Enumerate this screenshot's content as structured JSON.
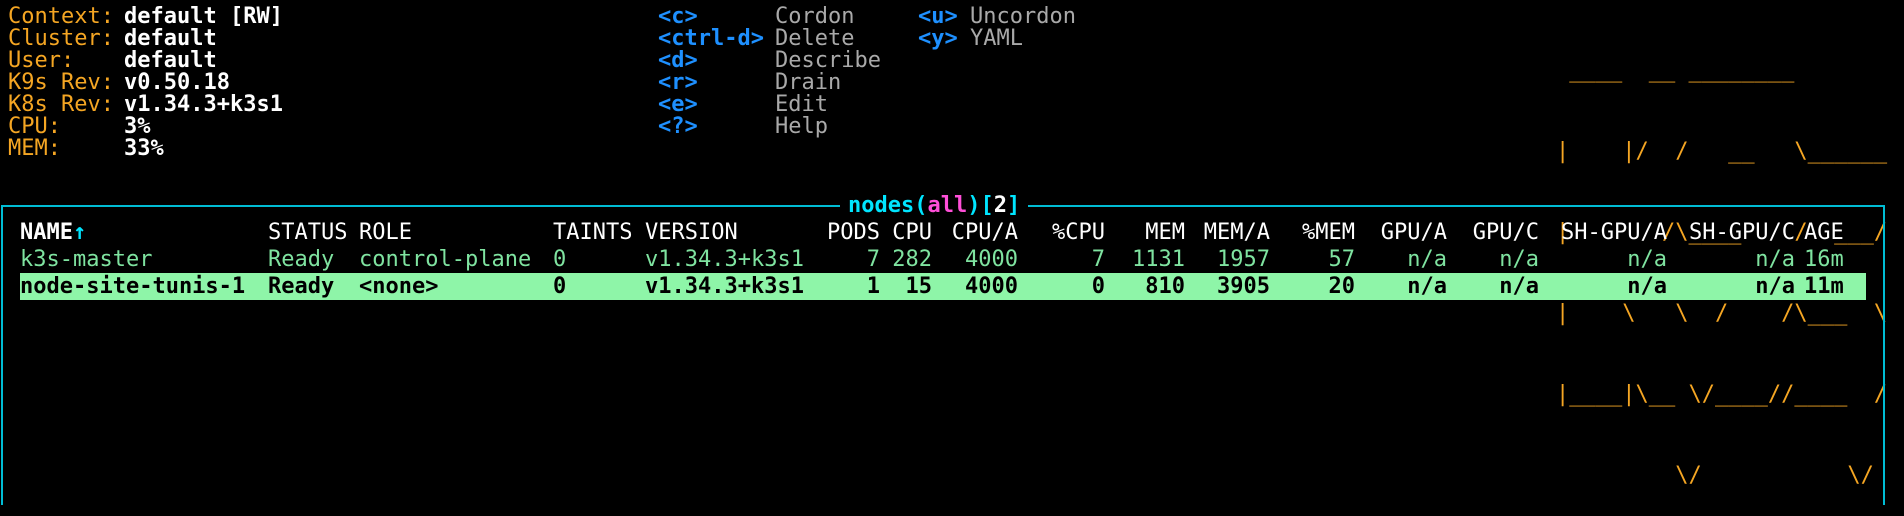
{
  "header": {
    "info": [
      {
        "label": "Context:",
        "value": "default [RW]"
      },
      {
        "label": "Cluster:",
        "value": "default"
      },
      {
        "label": "User:",
        "value": "default"
      },
      {
        "label": "K9s Rev:",
        "value": "v0.50.18"
      },
      {
        "label": "K8s Rev:",
        "value": "v1.34.3+k3s1"
      },
      {
        "label": "CPU:",
        "value": "3%"
      },
      {
        "label": "MEM:",
        "value": "33%"
      }
    ],
    "shortcuts_col1": [
      {
        "key": "<c>",
        "desc": "Cordon"
      },
      {
        "key": "<ctrl-d>",
        "desc": "Delete"
      },
      {
        "key": "<d>",
        "desc": "Describe"
      },
      {
        "key": "<r>",
        "desc": "Drain"
      },
      {
        "key": "<e>",
        "desc": "Edit"
      },
      {
        "key": "<?>",
        "desc": "Help"
      }
    ],
    "shortcuts_col2": [
      {
        "key": "<u>",
        "desc": "Uncordon"
      },
      {
        "key": "<y>",
        "desc": "YAML"
      }
    ],
    "logo_lines": [
      " ____  __ ________       ",
      "|    |/  /   __   \\______",
      "|       /\\____    /  ___/",
      "|    \\   \\  /    /\\___  \\",
      "|____|\\__ \\/____//____  /",
      "         \\/           \\/ "
    ]
  },
  "view": {
    "resource": "nodes",
    "namespace": "all",
    "count": "2",
    "open_paren": "(",
    "close_paren": ")",
    "open_bracket": "[",
    "close_bracket": "]"
  },
  "table": {
    "columns": [
      "NAME",
      "STATUS",
      "ROLE",
      "TAINTS",
      "VERSION",
      "PODS",
      "CPU",
      "CPU/A",
      "%CPU",
      "MEM",
      "MEM/A",
      "%MEM",
      "GPU/A",
      "GPU/C",
      "SH-GPU/A",
      "SH-GPU/C",
      "AGE"
    ],
    "sort_indicator": "↑",
    "rows": [
      {
        "name": "k3s-master",
        "status": "Ready",
        "role": "control-plane",
        "taints": "0",
        "version": "v1.34.3+k3s1",
        "pods": "7",
        "cpu": "282",
        "cpu_a": "4000",
        "pcpu": "7",
        "mem": "1131",
        "mem_a": "1957",
        "pmem": "57",
        "gpu_a": "n/a",
        "gpu_c": "n/a",
        "sh_gpu_a": "n/a",
        "sh_gpu_c": "n/a",
        "age": "16m"
      },
      {
        "name": "node-site-tunis-1",
        "status": "Ready",
        "role": "<none>",
        "taints": "0",
        "version": "v1.34.3+k3s1",
        "pods": "1",
        "cpu": "15",
        "cpu_a": "4000",
        "pcpu": "0",
        "mem": "810",
        "mem_a": "3905",
        "pmem": "20",
        "gpu_a": "n/a",
        "gpu_c": "n/a",
        "sh_gpu_a": "n/a",
        "sh_gpu_c": "n/a",
        "age": "11m"
      }
    ],
    "selected_row": 1
  },
  "colors": {
    "label": "#f5a623",
    "key": "#1e90ff",
    "border": "#00bcd4",
    "row_text": "#7fe3a0",
    "selected_bg": "#8ef5a8"
  }
}
